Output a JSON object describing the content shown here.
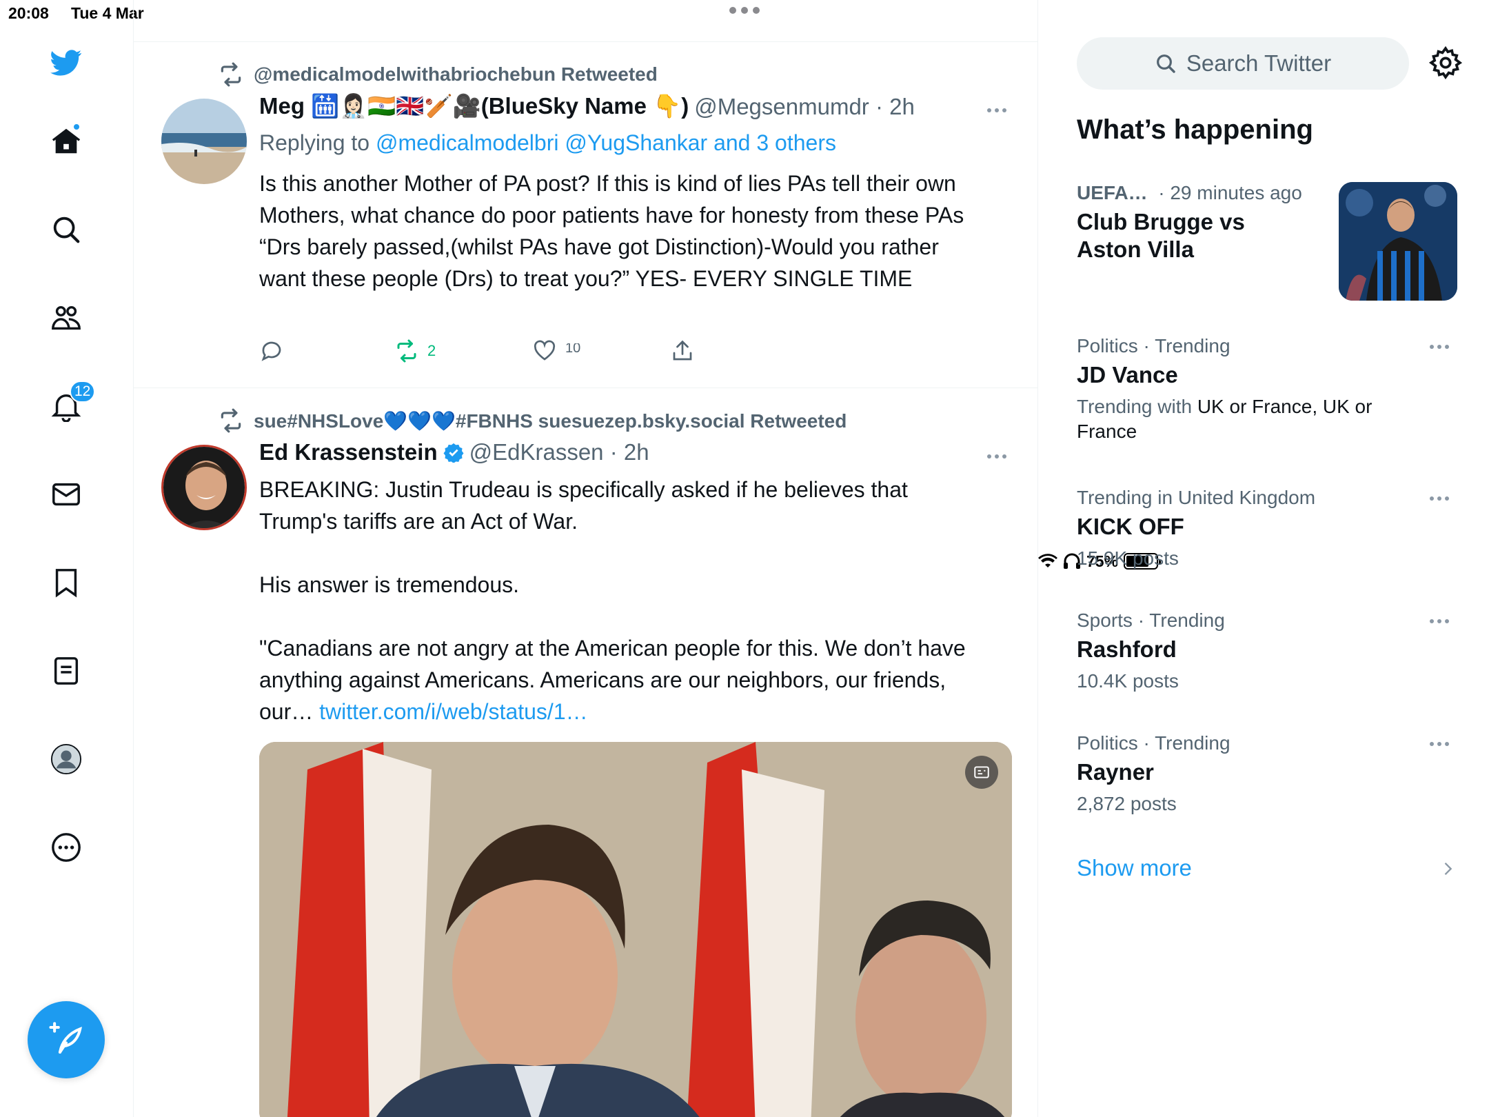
{
  "status_bar": {
    "time": "20:08",
    "date": "Tue 4 Mar",
    "battery": "75%",
    "battery_level": 0.75
  },
  "nav": {
    "items": [
      {
        "name": "twitter-logo-icon"
      },
      {
        "name": "home-icon",
        "has_dot": true
      },
      {
        "name": "search-icon"
      },
      {
        "name": "communities-icon"
      },
      {
        "name": "notifications-icon",
        "badge": "12"
      },
      {
        "name": "messages-icon"
      },
      {
        "name": "bookmarks-icon"
      },
      {
        "name": "lists-icon"
      },
      {
        "name": "profile-icon"
      },
      {
        "name": "more-icon"
      }
    ],
    "compose_icon": "compose-tweet-icon"
  },
  "timeline": {
    "tweets": [
      {
        "retweeted_by": "@medicalmodelwithabriochebun Retweeted",
        "name": "Meg 🛗👩🏻‍⚕️🇮🇳🇬🇧🏏🎥(BlueSky Name 👇)",
        "handle": "@Megsenmumdr · 2h",
        "replying_prefix": "Replying to ",
        "replying_to": "@medicalmodelbri @YugShankar and 3 others",
        "text_lines": [
          "Is this another Mother of PA post? If this is kind of lies PAs tell their own Mothers, what chance do poor patients have for honesty from these PAs",
          "“Drs barely passed,(whilst PAs have got Distinction)-Would you rather want these people (Drs) to treat you?”  YES- EVERY SINGLE TIME"
        ],
        "retweets": "2",
        "likes": "10"
      },
      {
        "retweeted_by": "sue#NHSLove💙💙💙#FBNHS suesuezep.bsky.social Retweeted",
        "name": "Ed Krassenstein",
        "verified": true,
        "handle": "@EdKrassen · 2h",
        "paragraphs": [
          "BREAKING: Justin Trudeau is specifically asked if he believes that Trump's tariffs are an Act of War.",
          "His answer is tremendous.",
          "\"Canadians are not angry at the American people for this. We don’t have anything against Americans. Americans are our neighbors, our friends, our… "
        ],
        "link": "twitter.com/i/web/status/1…"
      }
    ]
  },
  "sidebar": {
    "search_placeholder": "Search Twitter",
    "section_title": "What’s happening",
    "featured": {
      "category": "UEFA…",
      "time": "· 29 minutes ago",
      "title": "Club Brugge vs Aston Villa"
    },
    "trends": [
      {
        "meta": "Politics · Trending",
        "title": "JD Vance",
        "sub_prefix": "Trending with ",
        "sub_value": "UK or France, UK or France"
      },
      {
        "meta": "Trending in United Kingdom",
        "title": "KICK OFF",
        "sub": "15.9K posts"
      },
      {
        "meta": "Sports · Trending",
        "title": "Rashford",
        "sub": "10.4K posts"
      },
      {
        "meta": "Politics · Trending",
        "title": "Rayner",
        "sub": "2,872 posts"
      }
    ],
    "show_more": "Show more"
  },
  "colors": {
    "accent": "#1d9bf0",
    "retweet_green": "#00ba7c",
    "secondary_text": "#536471"
  }
}
